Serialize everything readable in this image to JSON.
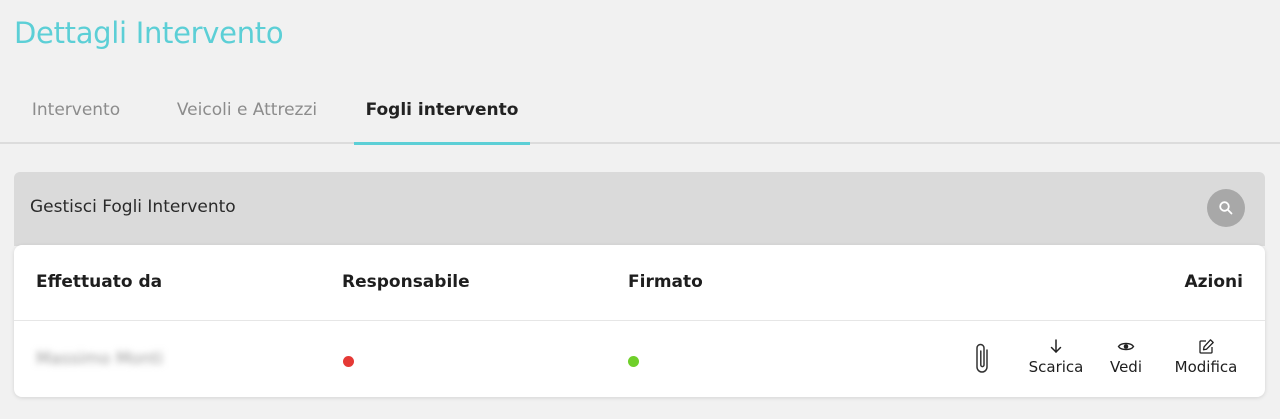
{
  "page": {
    "title": "Dettagli Intervento"
  },
  "tabs": [
    {
      "label": "Intervento",
      "active": false
    },
    {
      "label": "Veicoli e Attrezzi",
      "active": false
    },
    {
      "label": "Fogli intervento",
      "active": true
    }
  ],
  "panel": {
    "title": "Gestisci Fogli Intervento",
    "search_icon": "search-icon"
  },
  "table": {
    "columns": [
      "Effettuato da",
      "Responsabile",
      "Firmato",
      "Azioni"
    ],
    "rows": [
      {
        "effettuato_da": "Massimo Monti",
        "responsabile_status_color": "#e53935",
        "firmato_status_color": "#6fcf2a",
        "actions": [
          {
            "icon": "paperclip-icon",
            "label": ""
          },
          {
            "icon": "download-icon",
            "label": "Scarica"
          },
          {
            "icon": "eye-icon",
            "label": "Vedi"
          },
          {
            "icon": "edit-icon",
            "label": "Modifica"
          }
        ]
      }
    ]
  },
  "colors": {
    "accent": "#5ccfd6"
  }
}
